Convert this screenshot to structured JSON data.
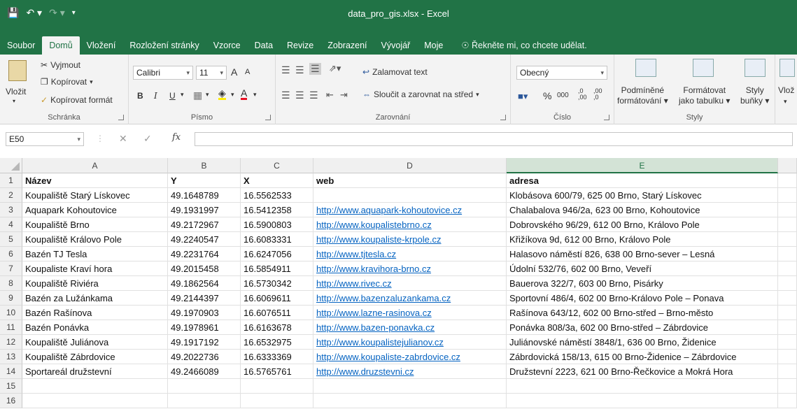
{
  "window": {
    "title": "data_pro_gis.xlsx - Excel"
  },
  "tabs": [
    {
      "label": "Soubor",
      "name": "tab-file",
      "active": false
    },
    {
      "label": "Domů",
      "name": "tab-home",
      "active": true
    },
    {
      "label": "Vložení",
      "name": "tab-insert",
      "active": false
    },
    {
      "label": "Rozložení stránky",
      "name": "tab-page-layout",
      "active": false
    },
    {
      "label": "Vzorce",
      "name": "tab-formulas",
      "active": false
    },
    {
      "label": "Data",
      "name": "tab-data",
      "active": false
    },
    {
      "label": "Revize",
      "name": "tab-review",
      "active": false
    },
    {
      "label": "Zobrazení",
      "name": "tab-view",
      "active": false
    },
    {
      "label": "Vývojář",
      "name": "tab-developer",
      "active": false
    },
    {
      "label": "Moje",
      "name": "tab-my",
      "active": false
    }
  ],
  "tell_me": "Řekněte mi, co chcete udělat.",
  "ribbon": {
    "clipboard": {
      "label": "Schránka",
      "paste": "Vložit",
      "cut": "Vyjmout",
      "copy": "Kopírovat",
      "format_painter": "Kopírovat formát"
    },
    "font": {
      "label": "Písmo",
      "family": "Calibri",
      "size": "11",
      "bold": "B",
      "italic": "I",
      "underline": "U",
      "grow": "A",
      "shrink": "A",
      "color_a": "A"
    },
    "alignment": {
      "label": "Zarovnání",
      "wrap": "Zalamovat text",
      "merge": "Sloučit a zarovnat na střed"
    },
    "number": {
      "label": "Číslo",
      "format": "Obecný",
      "percent": "%",
      "thousands": "000",
      "inc_decimal": ",0 ,00",
      "dec_decimal": ",00 ,0"
    },
    "styles": {
      "label": "Styly",
      "conditional_1": "Podmíněné",
      "conditional_2": "formátování",
      "table_1": "Formátovat",
      "table_2": "jako tabulku",
      "cell_1": "Styly",
      "cell_2": "buňky"
    },
    "cells": {
      "insert": "Vlož"
    }
  },
  "formula_bar": {
    "name_box": "E50",
    "fx": "fx",
    "formula": ""
  },
  "columns": [
    "A",
    "B",
    "C",
    "D",
    "E"
  ],
  "selected_column": "E",
  "row_numbers": [
    "1",
    "2",
    "3",
    "4",
    "5",
    "6",
    "7",
    "8",
    "9",
    "10",
    "11",
    "12",
    "13",
    "14",
    "15",
    "16"
  ],
  "rows": [
    [
      "Název",
      "Y",
      "X",
      "web",
      "adresa"
    ],
    [
      "Koupaliště Starý Lískovec",
      "49.1648789",
      "16.5562533",
      "",
      "Klobásova 600/79, 625 00  Brno, Starý Lískovec"
    ],
    [
      "Aquapark Kohoutovice",
      "49.1931997",
      "16.5412358",
      "http://www.aquapark-kohoutovice.cz",
      "Chalabalova 946/2a, 623 00  Brno, Kohoutovice"
    ],
    [
      "Koupaliště Brno",
      "49.2172967",
      "16.5900803",
      "http://www.koupalistebrno.cz",
      "Dobrovského 96/29, 612 00  Brno, Královo Pole"
    ],
    [
      "Koupaliště Královo Pole",
      "49.2240547",
      "16.6083331",
      "http://www.koupaliste-krpole.cz",
      "Křižíkova 9d, 612 00 Brno, Královo Pole"
    ],
    [
      "Bazén TJ Tesla",
      "49.2231764",
      "16.6247056",
      "http://www.tjtesla.cz",
      "Halasovo náměstí 826, 638 00  Brno-sever – Lesná"
    ],
    [
      "Koupaliste Kraví hora",
      "49.2015458",
      "16.5854911",
      "http://www.kravihora-brno.cz",
      "Údolní 532/76, 602 00 Brno, Veveří"
    ],
    [
      "Koupaliště Riviéra",
      "49.1862564",
      "16.5730342",
      "http://www.rivec.cz",
      "Bauerova 322/7, 603 00 Brno, Pisárky"
    ],
    [
      "Bazén za Lužánkama",
      "49.2144397",
      "16.6069611",
      "http://www.bazenzaluzankama.cz",
      "Sportovní 486/4, 602 00  Brno-Královo Pole – Ponava"
    ],
    [
      "Bazén Rašínova",
      "49.1970903",
      "16.6076511",
      "http://www.lazne-rasinova.cz",
      "Rašínova 643/12, 602 00  Brno-střed – Brno-město"
    ],
    [
      "Bazén Ponávka",
      "49.1978961",
      "16.6163678",
      "http://www.bazen-ponavka.cz",
      "Ponávka 808/3a, 602 00  Brno-střed – Zábrdovice"
    ],
    [
      "Koupaliště Juliánova",
      "49.1917192",
      "16.6532975",
      "http://www.koupalistejulianov.cz",
      "Juliánovské náměstí 3848/1, 636 00  Brno, Židenice"
    ],
    [
      "Koupaliště Zábrdovice",
      "49.2022736",
      "16.6333369",
      "http://www.koupaliste-zabrdovice.cz",
      "Zábrdovická 158/13, 615 00  Brno-Židenice – Zábrdovice"
    ],
    [
      "Sportareál družstevní",
      "49.2466089",
      "16.5765761",
      "http://www.druzstevni.cz",
      "Družstevní 2223, 621 00  Brno-Řečkovice a Mokrá Hora"
    ],
    [
      "",
      "",
      "",
      "",
      ""
    ],
    [
      "",
      "",
      "",
      "",
      ""
    ]
  ],
  "colors": {
    "excel_green": "#217346",
    "link": "#0563c1"
  }
}
